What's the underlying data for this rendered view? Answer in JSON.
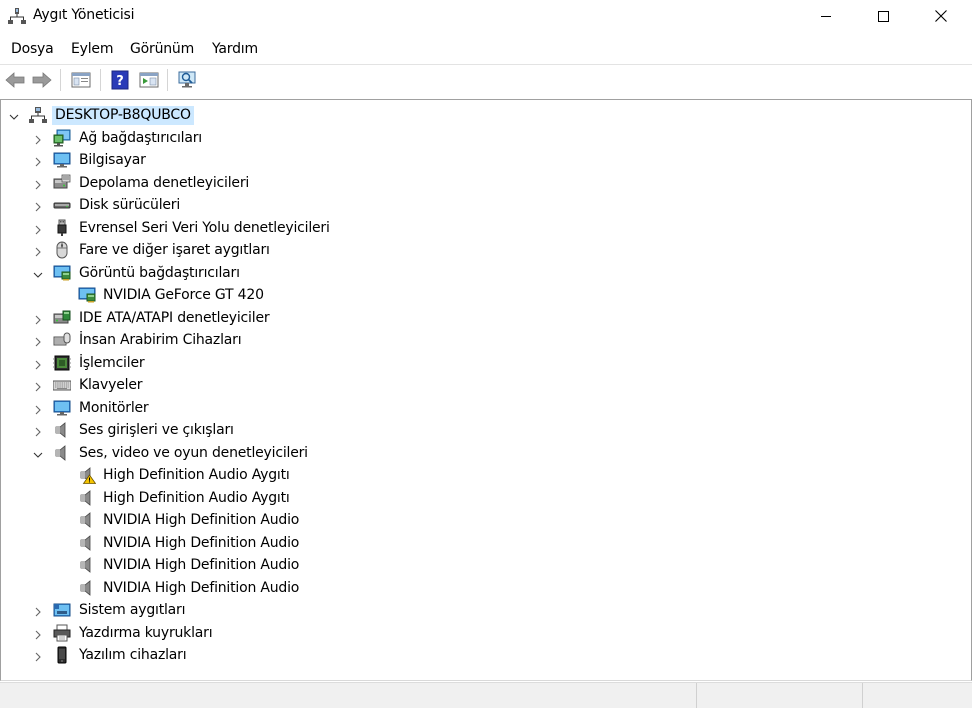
{
  "window": {
    "title": "Aygıt Yöneticisi"
  },
  "menu": {
    "items": [
      "Dosya",
      "Eylem",
      "Görünüm",
      "Yardım"
    ]
  },
  "tree": {
    "root": "DESKTOP-B8QUBCO",
    "items": [
      {
        "label": "Ağ bağdaştırıcıları",
        "icon": "network-adapter-icon",
        "expanded": false
      },
      {
        "label": "Bilgisayar",
        "icon": "computer-icon",
        "expanded": false
      },
      {
        "label": "Depolama denetleyicileri",
        "icon": "storage-controller-icon",
        "expanded": false
      },
      {
        "label": "Disk sürücüleri",
        "icon": "disk-drive-icon",
        "expanded": false
      },
      {
        "label": "Evrensel Seri Veri Yolu denetleyicileri",
        "icon": "usb-icon",
        "expanded": false
      },
      {
        "label": "Fare ve diğer işaret aygıtları",
        "icon": "mouse-icon",
        "expanded": false
      },
      {
        "label": "Görüntü bağdaştırıcıları",
        "icon": "display-adapter-icon",
        "expanded": true,
        "children": [
          {
            "label": "NVIDIA GeForce GT 420",
            "icon": "display-adapter-icon"
          }
        ]
      },
      {
        "label": "IDE ATA/ATAPI denetleyiciler",
        "icon": "ide-controller-icon",
        "expanded": false
      },
      {
        "label": "İnsan Arabirim Cihazları",
        "icon": "hid-icon",
        "expanded": false
      },
      {
        "label": "İşlemciler",
        "icon": "processor-icon",
        "expanded": false
      },
      {
        "label": "Klavyeler",
        "icon": "keyboard-icon",
        "expanded": false
      },
      {
        "label": "Monitörler",
        "icon": "monitor-icon",
        "expanded": false
      },
      {
        "label": "Ses girişleri ve çıkışları",
        "icon": "speaker-icon",
        "expanded": false
      },
      {
        "label": "Ses, video ve oyun denetleyicileri",
        "icon": "speaker-icon",
        "expanded": true,
        "children": [
          {
            "label": "High Definition Audio Aygıtı",
            "icon": "speaker-warning-icon"
          },
          {
            "label": "High Definition Audio Aygıtı",
            "icon": "speaker-icon"
          },
          {
            "label": "NVIDIA High Definition Audio",
            "icon": "speaker-icon"
          },
          {
            "label": "NVIDIA High Definition Audio",
            "icon": "speaker-icon"
          },
          {
            "label": "NVIDIA High Definition Audio",
            "icon": "speaker-icon"
          },
          {
            "label": "NVIDIA High Definition Audio",
            "icon": "speaker-icon"
          }
        ]
      },
      {
        "label": "Sistem aygıtları",
        "icon": "system-devices-icon",
        "expanded": false
      },
      {
        "label": "Yazdırma kuyrukları",
        "icon": "printer-icon",
        "expanded": false
      },
      {
        "label": "Yazılım cihazları",
        "icon": "software-device-icon",
        "expanded": false
      }
    ]
  },
  "colors": {
    "selection": "#cce8ff",
    "accent": "#0078d7"
  }
}
